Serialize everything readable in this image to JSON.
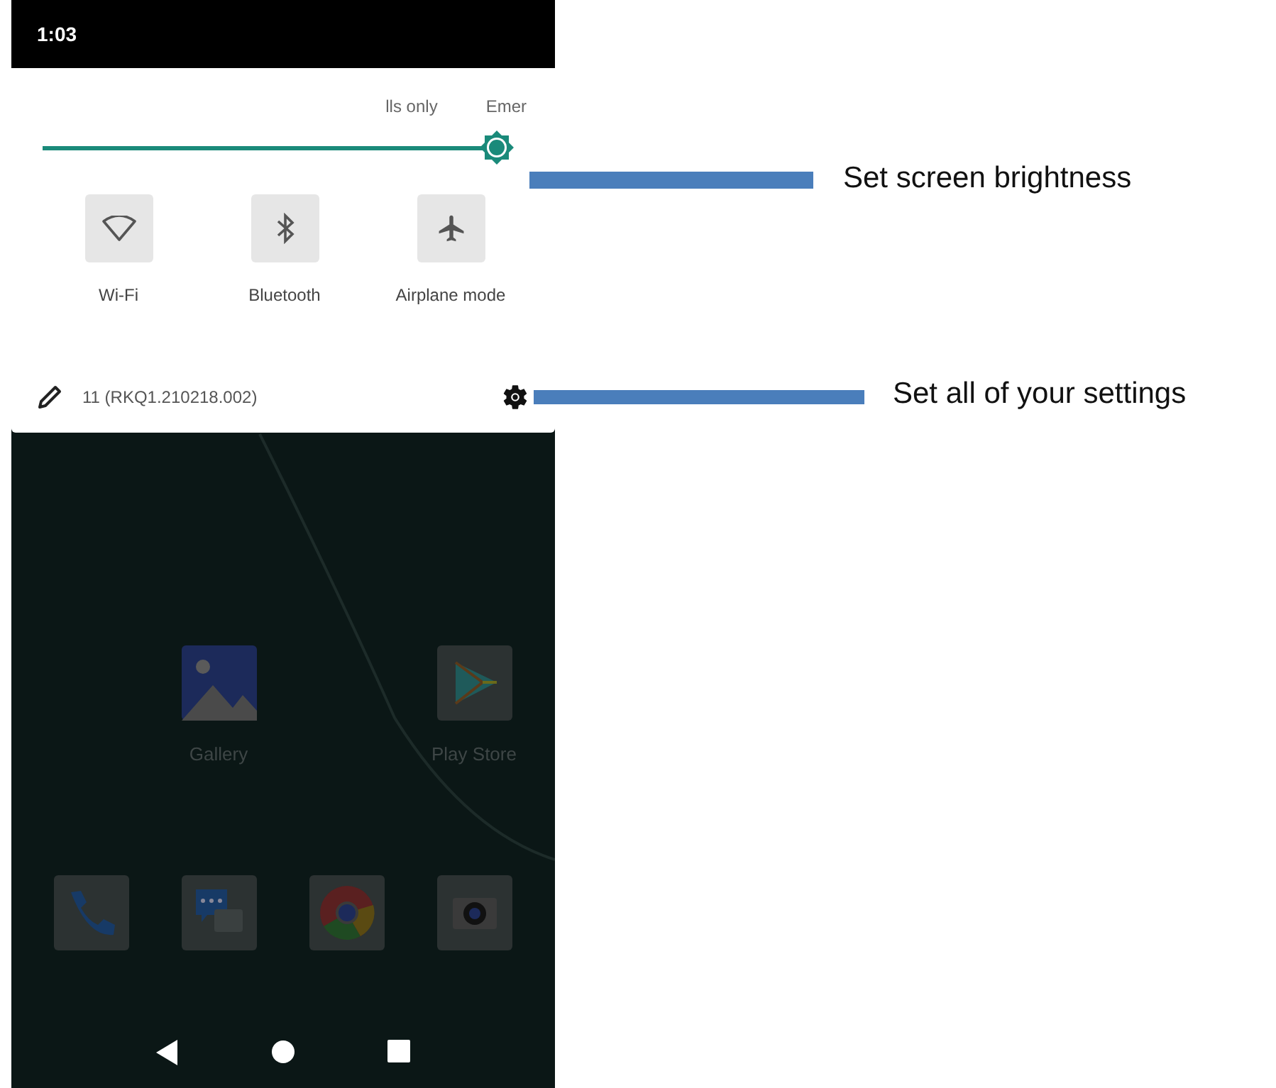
{
  "status_bar": {
    "time": "1:03"
  },
  "quick_settings": {
    "header": [
      "lls only",
      "Emer"
    ],
    "brightness": {
      "level": 1
    },
    "tiles": [
      {
        "label": "Wi-Fi",
        "kind": "wifi",
        "on": false
      },
      {
        "label": "Bluetooth",
        "kind": "bluetooth",
        "on": false
      },
      {
        "label": "Airplane mode",
        "kind": "airplane",
        "on": false
      }
    ],
    "footer": {
      "build": "11 (RKQ1.210218.002)"
    }
  },
  "home": {
    "apps": [
      {
        "label": "Gallery",
        "kind": "gallery"
      },
      {
        "label": "Play Store",
        "kind": "play"
      }
    ],
    "dock": [
      {
        "kind": "phone"
      },
      {
        "kind": "messages"
      },
      {
        "kind": "chrome"
      },
      {
        "kind": "camera"
      }
    ]
  },
  "annotations": [
    {
      "text": "Set screen brightness"
    },
    {
      "text": "Set all of your settings"
    }
  ]
}
